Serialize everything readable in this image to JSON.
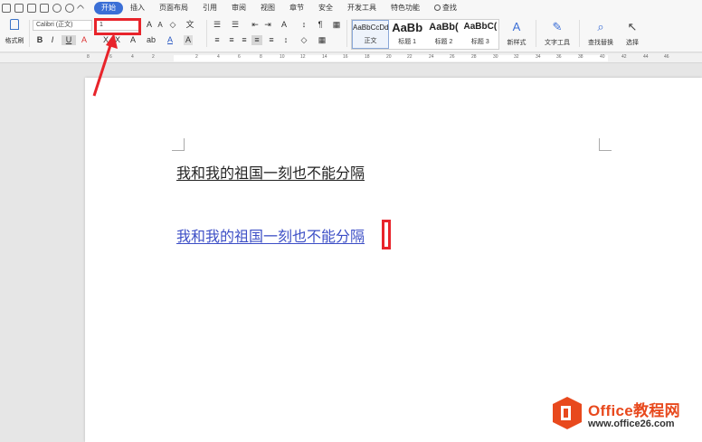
{
  "menubar": {
    "tabs": [
      "开始",
      "插入",
      "页面布局",
      "引用",
      "审阅",
      "视图",
      "章节",
      "安全",
      "开发工具",
      "特色功能"
    ],
    "active_tab": "开始",
    "search_label": "查找"
  },
  "ribbon": {
    "format_painter_label": "格式刷",
    "font_name": "Calibri (正文)",
    "font_size": "1",
    "bold": "B",
    "italic": "I",
    "underline": "U",
    "styles": [
      {
        "sample": "AaBbCcDd",
        "name": "正文"
      },
      {
        "sample": "AaBb",
        "name": "标题 1"
      },
      {
        "sample": "AaBb(",
        "name": "标题 2"
      },
      {
        "sample": "AaBbC(",
        "name": "标题 3"
      }
    ],
    "new_style_label": "新样式",
    "text_tools_label": "文字工具",
    "find_replace_label": "查找替换",
    "select_label": "选择"
  },
  "ruler": {
    "ticks": [
      "8",
      "6",
      "4",
      "2",
      "2",
      "4",
      "6",
      "8",
      "10",
      "12",
      "14",
      "16",
      "18",
      "20",
      "22",
      "24",
      "26",
      "28",
      "30",
      "32",
      "34",
      "36",
      "38",
      "40",
      "42",
      "44",
      "46"
    ]
  },
  "document": {
    "line1": "我和我的祖国一刻也不能分隔",
    "line2": "我和我的祖国一刻也不能分隔"
  },
  "watermark": {
    "brand": "Office教程网",
    "url": "www.office26.com"
  },
  "colors": {
    "accent": "#3b6fd6",
    "highlight": "#e8242b",
    "line2_text": "#3d4fc6",
    "watermark_orange": "#e8491d"
  }
}
